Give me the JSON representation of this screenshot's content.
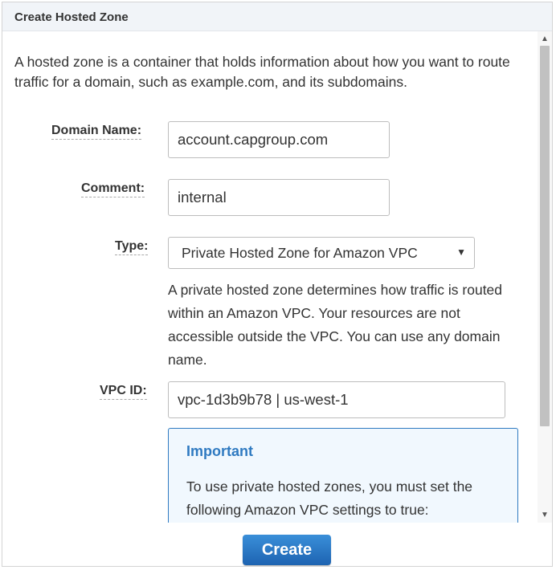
{
  "dialog": {
    "title": "Create Hosted Zone",
    "description": "A hosted zone is a container that holds information about how you want to route traffic for a domain, such as example.com, and its subdomains."
  },
  "form": {
    "domain_name": {
      "label": "Domain Name:",
      "value": "account.capgroup.com"
    },
    "comment": {
      "label": "Comment:",
      "value": "internal"
    },
    "type": {
      "label": "Type:",
      "selected": "Private Hosted Zone for Amazon VPC",
      "help": "A private hosted zone determines how traffic is routed within an Amazon VPC. Your resources are not accessible outside the VPC. You can use any domain name."
    },
    "vpc_id": {
      "label": "VPC ID:",
      "value": "vpc-1d3b9b78 | us-west-1"
    }
  },
  "important": {
    "title": "Important",
    "text": "To use private hosted zones, you must set the following Amazon VPC settings to true:"
  },
  "icons": {
    "select_arrow": "▼",
    "scroll_up": "▲",
    "scroll_down": "▼"
  },
  "footer": {
    "create_label": "Create"
  },
  "colors": {
    "accent": "#2f7ac1",
    "button": "#1d63b1",
    "header_bg": "#f1f4f8"
  }
}
